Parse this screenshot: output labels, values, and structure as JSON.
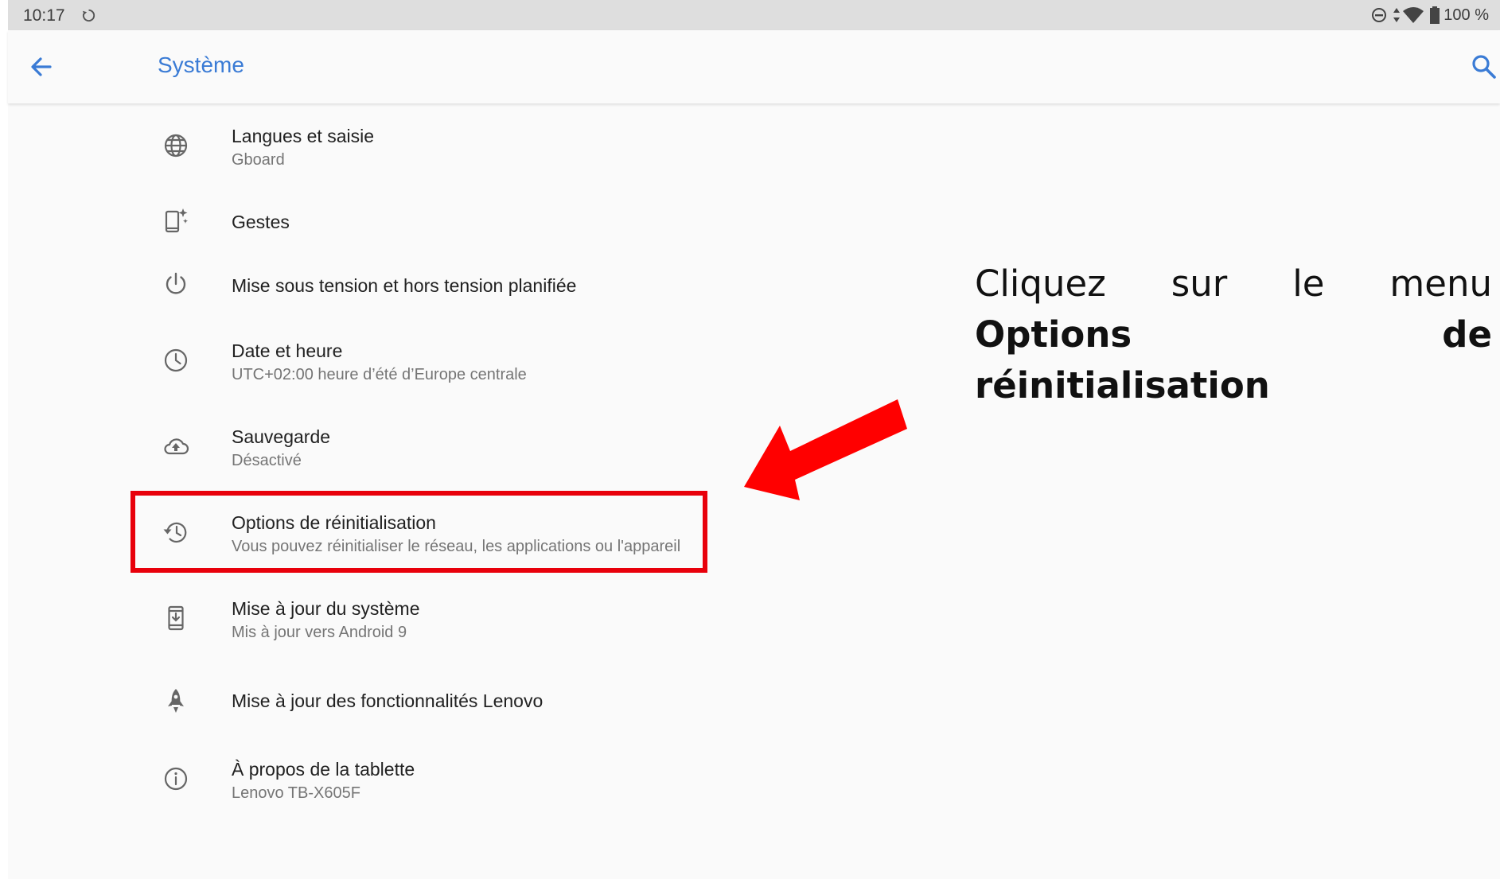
{
  "statusbar": {
    "time": "10:17",
    "battery": "100 %",
    "icons": [
      "sync-icon",
      "do-not-disturb-icon",
      "data-arrows-icon",
      "wifi-icon",
      "battery-icon"
    ]
  },
  "appbar": {
    "title": "Système",
    "accent_color": "#3a7bd5",
    "icons": [
      "back-arrow-icon",
      "search-icon"
    ]
  },
  "settings": {
    "items": [
      {
        "icon": "globe-icon",
        "title": "Langues et saisie",
        "subtitle": "Gboard"
      },
      {
        "icon": "gestures-phone-icon",
        "title": "Gestes",
        "subtitle": ""
      },
      {
        "icon": "power-icon",
        "title": "Mise sous tension et hors tension planifiée",
        "subtitle": ""
      },
      {
        "icon": "clock-icon",
        "title": "Date et heure",
        "subtitle": "UTC+02:00 heure d’été d’Europe centrale"
      },
      {
        "icon": "cloud-backup-icon",
        "title": "Sauvegarde",
        "subtitle": "Désactivé"
      },
      {
        "icon": "history-restore-icon",
        "title": "Options de réinitialisation",
        "subtitle": "Vous pouvez réinitialiser le réseau, les applications ou l'appareil"
      },
      {
        "icon": "system-update-icon",
        "title": "Mise à jour du système",
        "subtitle": "Mis à jour vers Android 9"
      },
      {
        "icon": "rocket-icon",
        "title": "Mise à jour des fonctionnalités Lenovo",
        "subtitle": ""
      },
      {
        "icon": "info-icon",
        "title": "À propos de la tablette",
        "subtitle": "Lenovo TB-X605F"
      }
    ]
  },
  "annotation": {
    "text_lead": "Cliquez sur le menu ",
    "text_bold": "Options de réinitialisation",
    "highlight_color": "#e8000b"
  }
}
